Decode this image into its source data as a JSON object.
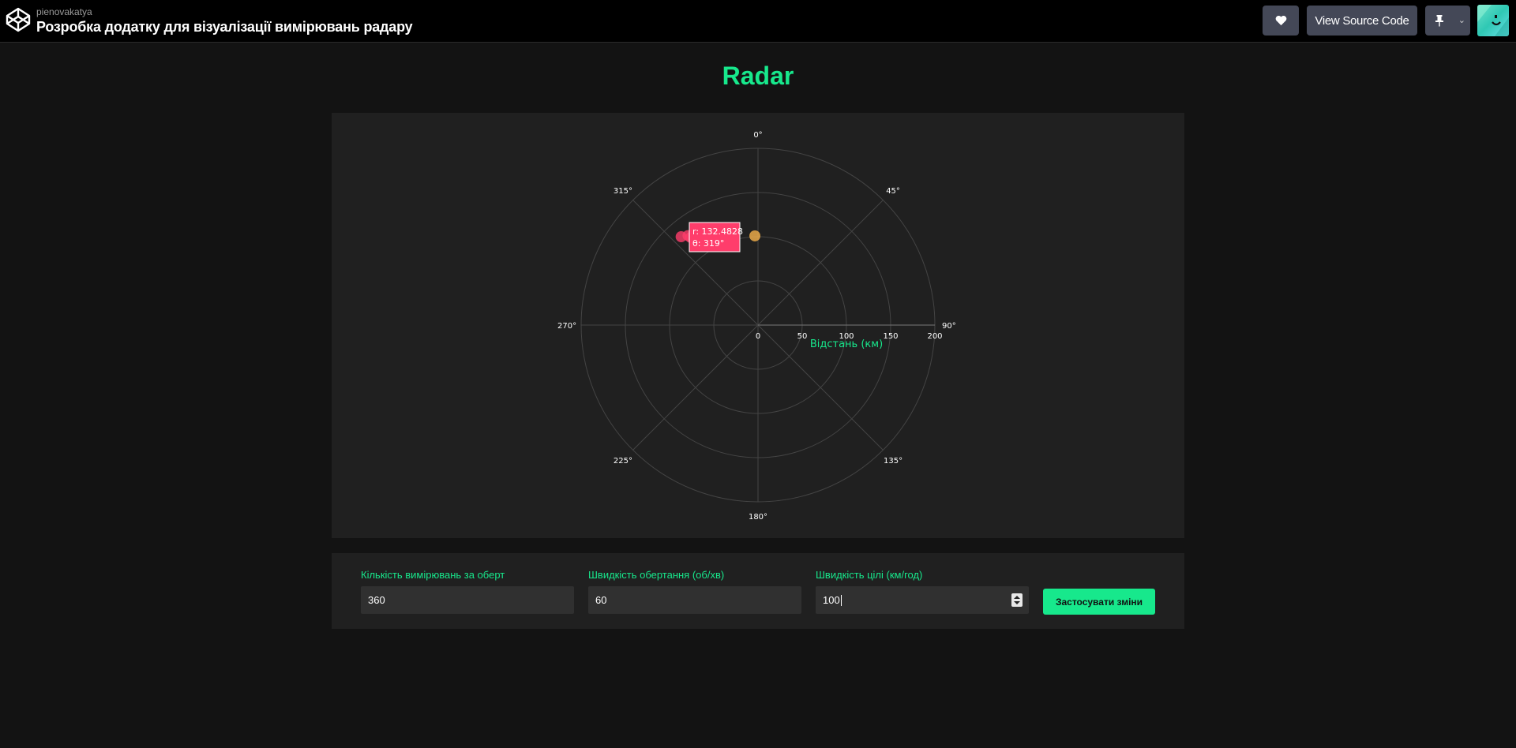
{
  "header": {
    "author": "pienovakatya",
    "title": "Розробка додатку для візуалізації вимірювань радару",
    "view_source_label": "View Source Code",
    "icons": {
      "logo": "codepen-logo-icon",
      "heart": "heart-icon",
      "pin": "pin-icon",
      "chevron": "chevron-down-icon"
    }
  },
  "page": {
    "heading": "Radar"
  },
  "chart_data": {
    "type": "scatter",
    "subtype": "polar",
    "angular_tick_labels": [
      "0°",
      "45°",
      "90°",
      "135°",
      "180°",
      "225°",
      "270°",
      "315°"
    ],
    "radial_tick_labels": [
      "0",
      "50",
      "100",
      "150",
      "200"
    ],
    "radial_range": [
      0,
      200
    ],
    "radial_axis_title": "Відстань (км)",
    "grid": true,
    "points": [
      {
        "r": 132.4828,
        "theta": 319,
        "color": "#ff3d6b"
      },
      {
        "r": 128.5,
        "theta": 322,
        "color": "#ff3d6b"
      },
      {
        "r": 125.0,
        "theta": 322.5,
        "color": "#ff3d6b"
      },
      {
        "r": 101,
        "theta": 358,
        "color": "#f6b24b"
      }
    ],
    "tooltip": {
      "r_text": "r: 132.4828",
      "theta_text": "θ: 319°"
    },
    "colors": {
      "grid": "#444444",
      "axis_title": "#17e88c",
      "point": "#ff3d6b",
      "tooltip_bg": "#ff3d6b"
    }
  },
  "controls": {
    "measurements_label": "Кількість вимірювань за оберт",
    "measurements_value": "360",
    "rotation_label": "Швидкість обертання (об/хв)",
    "rotation_value": "60",
    "target_speed_label": "Швидкість цілі (км/год)",
    "target_speed_value": "100",
    "apply_label": "Застосувати зміни"
  },
  "colors": {
    "accent": "#17e88c",
    "background": "#131313",
    "panel": "#202020",
    "button": "#444857"
  }
}
